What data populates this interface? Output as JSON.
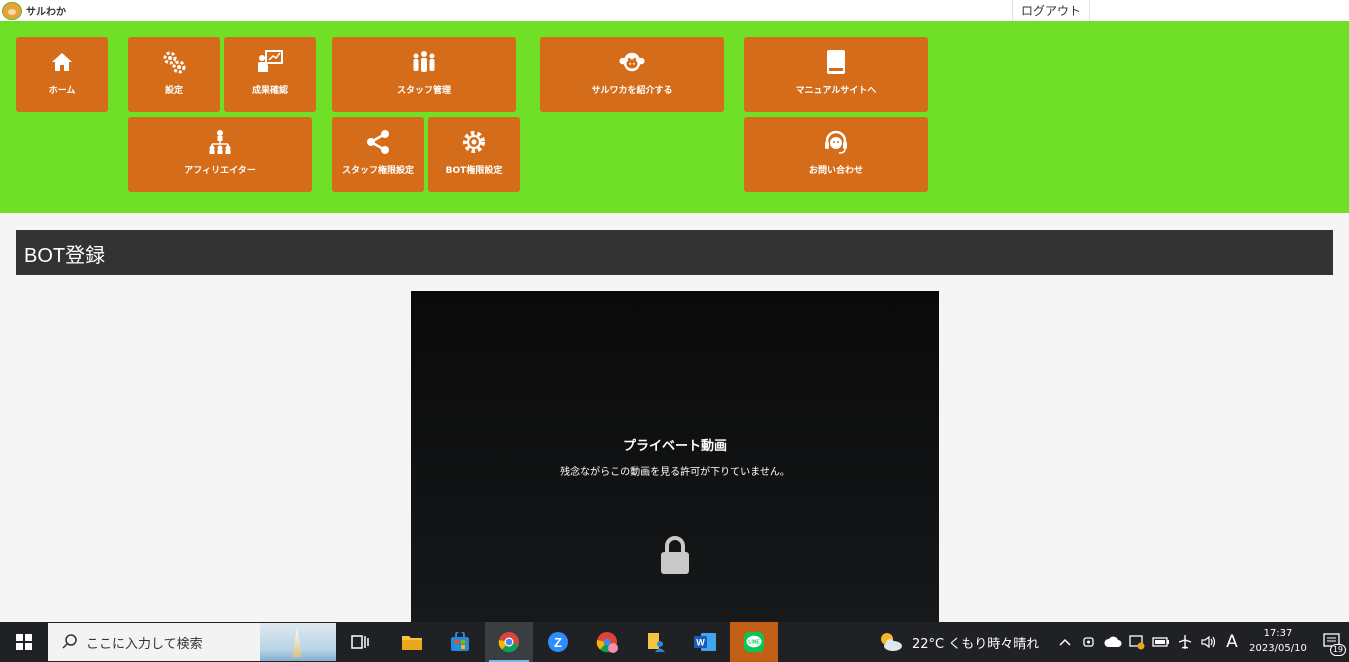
{
  "app": {
    "logo_text": "サルわか",
    "logout_label": "ログアウト"
  },
  "nav": {
    "home": "ホーム",
    "settings": "設定",
    "results": "成果確認",
    "staff": "スタッフ管理",
    "introduce": "サルワカを紹介する",
    "manual": "マニュアルサイトへ",
    "affiliate": "アフィリエイター",
    "staff_permissions": "スタッフ権限設定",
    "bot_permissions": "BOT権限設定",
    "contact": "お問い合わせ"
  },
  "page": {
    "title": "BOT登録"
  },
  "video": {
    "title": "プライベート動画",
    "message": "残念ながらこの動画を見る許可が下りていません。"
  },
  "taskbar": {
    "search_placeholder": "ここに入力して検索",
    "weather": "22°C くもり時々晴れ",
    "ime": "A",
    "time": "17:37",
    "date": "2023/05/10",
    "notifications": "19"
  },
  "colors": {
    "nav_bg": "#70e026",
    "tile": "#d46c1a",
    "header": "#333333",
    "taskbar": "#1f2124"
  },
  "icons": [
    "home-icon",
    "gears-icon",
    "presentation-icon",
    "team-icon",
    "monkey-icon",
    "book-icon",
    "hierarchy-icon",
    "share-icon",
    "gear-icon",
    "headset-icon",
    "lock-icon"
  ]
}
